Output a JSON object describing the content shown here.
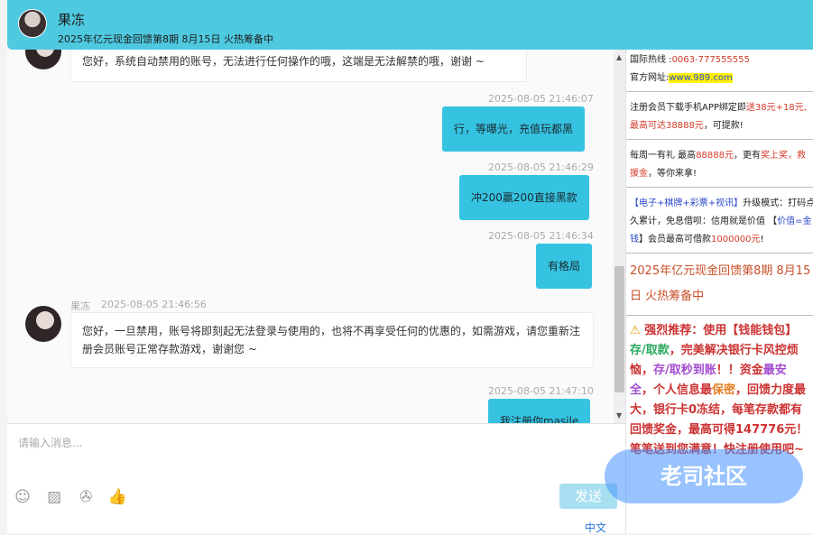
{
  "header": {
    "name": "果冻",
    "subtitle": "2025年亿元现金回馈第8期 8月15日 火热筹备中"
  },
  "messages": {
    "m1_text": "您好，系统自动禁用的账号，无法进行任何操作的哦，这端是无法解禁的哦，谢谢 ~",
    "m2_ts": "2025-08-05 21:46:07",
    "m2_text": "行，等曝光，充值玩都黑",
    "m3_ts": "2025-08-05 21:46:29",
    "m3_text": "冲200赢200直接黑款",
    "m4_ts": "2025-08-05 21:46:34",
    "m4_text": "有格局",
    "m5_sender": "果冻",
    "m5_ts": "2025-08-05 21:46:56",
    "m5_text": "您好，一旦禁用，账号将即刻起无法登录与使用的，也将不再享受任何的优惠的，如需游戏，请您重新注册会员账号正常存款游戏，谢谢您 ~",
    "m6_ts": "2025-08-05 21:47:10",
    "m6_text": "我注册你masile"
  },
  "input": {
    "placeholder": "请输入消息...",
    "send_label": "发送",
    "lang_label": "中文"
  },
  "tools": {
    "emoji_icon": "☺",
    "image_icon": "▨",
    "file_icon": "✇",
    "like_icon": "👍"
  },
  "sidebar": {
    "hotline_label": "国际热线 :",
    "hotline_value": "0063-777555555",
    "site_label": "官方网址:",
    "site_value": "www.989.com",
    "register_1": "注册会员下载手机APP绑定即",
    "register_2": "送38元+18元,",
    "register_3": "最高可达38888元",
    "register_4": "，可提款!",
    "weekly_1": "每周一有礼 最高",
    "weekly_2": "88888元",
    "weekly_3": "，更有",
    "weekly_4": "奖上奖",
    "weekly_5": "，救",
    "weekly_6": "援金",
    "weekly_7": "，等你来拿!",
    "mode_1": "【电子+棋牌+彩票+视讯】",
    "mode_2": "升级模式：打码点",
    "mode_3": "久累计，免息借呗：信用就是价值 【",
    "mode_4": "价值=金",
    "mode_5": "钱",
    "mode_6": "】会员最高可借款",
    "mode_7": "1000000元",
    "mode_8": "!",
    "event_line1": "2025年亿元现金回馈第8期 8月15",
    "event_line2": "日 火热筹备中",
    "promo_warn": "⚠",
    "promo_1": "强烈推荐：",
    "promo_2": "使用【钱能钱包】",
    "promo_3": "存/取款",
    "promo_4": "，完美解决银行卡风控烦恼，",
    "promo_5": "存/取秒到账",
    "promo_6": "！！资金",
    "promo_7": "最安全",
    "promo_8": "，个人信息最",
    "promo_9": "保密",
    "promo_10": "，回馈力度最大，银行卡0冻结，每笔存款都有回馈奖金，最高可得147776元！笔笔送到您满意！快注册使用吧~",
    "watermark": "老司社区"
  }
}
